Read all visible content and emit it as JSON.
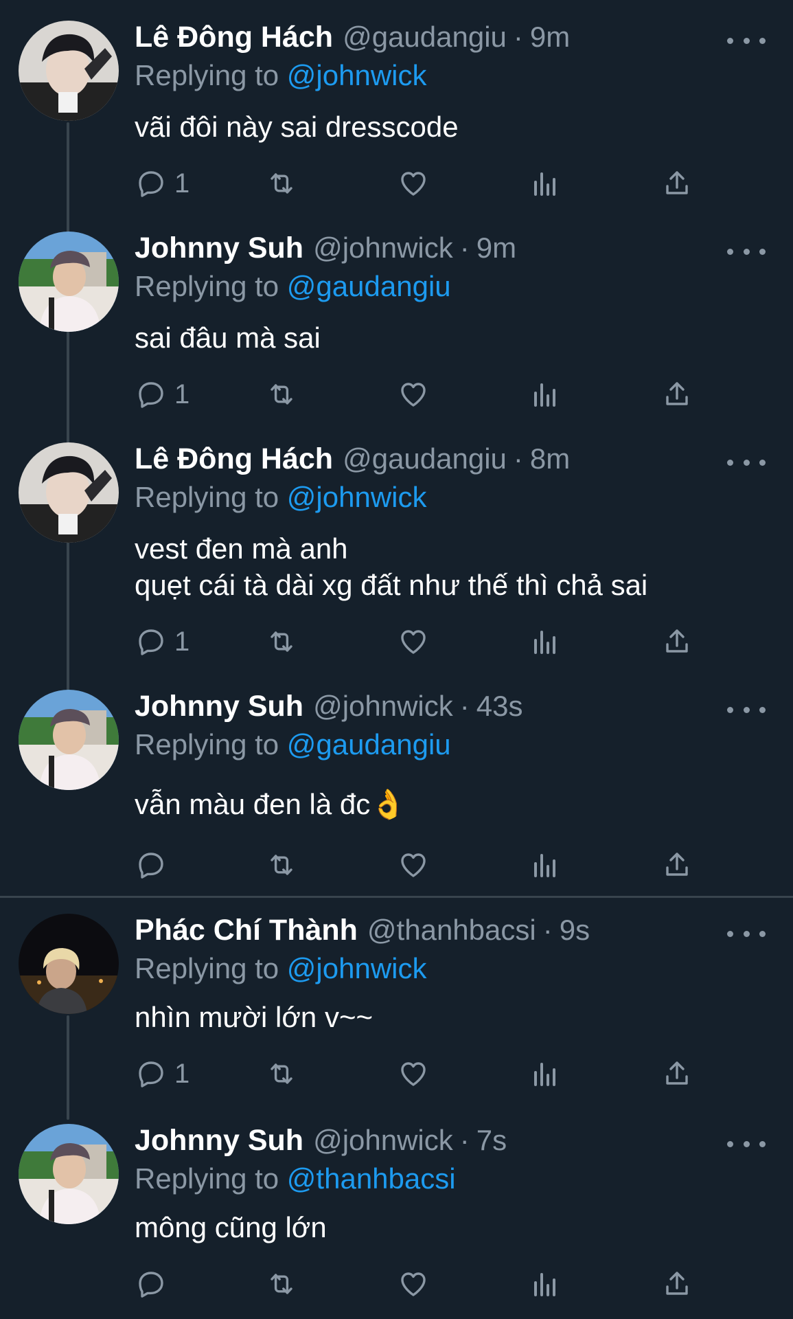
{
  "threads": [
    {
      "tweets": [
        {
          "name": "Lê Đông Hách",
          "handle": "@gaudangiu",
          "time": "9m",
          "reply_prefix": "Replying to",
          "reply_to": "@johnwick",
          "text": "vãi đôi này sai dresscode",
          "reply_count": "1",
          "avatar_icon": "avatar-dark-hair-photo"
        },
        {
          "name": "Johnny Suh",
          "handle": "@johnwick",
          "time": "9m",
          "reply_prefix": "Replying to",
          "reply_to": "@gaudangiu",
          "text": "sai đâu mà sai",
          "reply_count": "1",
          "avatar_icon": "avatar-cap-outdoor-photo"
        },
        {
          "name": "Lê Đông Hách",
          "handle": "@gaudangiu",
          "time": "8m",
          "reply_prefix": "Replying to",
          "reply_to": "@johnwick",
          "text": "vest đen mà anh\nquẹt cái tà dài xg đất như thế thì chả sai",
          "reply_count": "1",
          "avatar_icon": "avatar-dark-hair-photo"
        },
        {
          "name": "Johnny Suh",
          "handle": "@johnwick",
          "time": "43s",
          "reply_prefix": "Replying to",
          "reply_to": "@gaudangiu",
          "text": "vẫn màu đen là đc👌",
          "reply_count": "",
          "avatar_icon": "avatar-cap-outdoor-photo"
        }
      ]
    },
    {
      "tweets": [
        {
          "name": "Phác Chí Thành",
          "handle": "@thanhbacsi",
          "time": "9s",
          "reply_prefix": "Replying to",
          "reply_to": "@johnwick",
          "text": "nhìn mười lớn v~~",
          "reply_count": "1",
          "avatar_icon": "avatar-blonde-night-photo"
        },
        {
          "name": "Johnny Suh",
          "handle": "@johnwick",
          "time": "7s",
          "reply_prefix": "Replying to",
          "reply_to": "@thanhbacsi",
          "text": "mông cũng lớn",
          "reply_count": "",
          "avatar_icon": "avatar-cap-outdoor-photo"
        }
      ]
    }
  ],
  "separator": "·",
  "icons": {
    "reply": "reply-icon",
    "retweet": "retweet-icon",
    "like": "like-icon",
    "analytics": "analytics-icon",
    "share": "share-icon",
    "more": "more-icon"
  },
  "colors": {
    "background": "#15202b",
    "secondary_text": "#8b98a5",
    "link": "#1d9bf0",
    "divider": "#38444d"
  }
}
